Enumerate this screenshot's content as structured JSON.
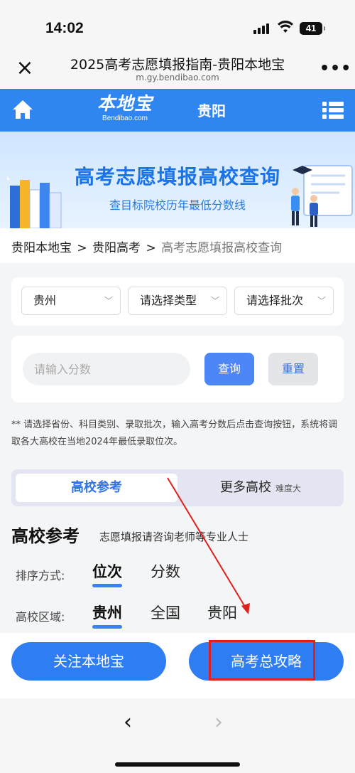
{
  "status_bar": {
    "time": "14:02",
    "battery": "41"
  },
  "browser": {
    "title": "2025高考志愿填报指南-贵阳本地宝",
    "url": "m.gy.bendibao.com",
    "more": "•••"
  },
  "site_nav": {
    "logo_cn": "本地宝",
    "logo_en": "Bendibao.com",
    "city": "贵阳"
  },
  "banner": {
    "title": "高考志愿填报高校查询",
    "subtitle": "查目标院校历年最低分数线"
  },
  "breadcrumb": {
    "items": [
      "贵阳本地宝",
      "贵阳高考"
    ],
    "separator": ">",
    "current": "高考志愿填报高校查询"
  },
  "selectors": {
    "province": "贵州",
    "type": "请选择类型",
    "batch": "请选择批次"
  },
  "score": {
    "placeholder": "请输入分数",
    "query_label": "查询",
    "reset_label": "重置"
  },
  "note": "** 请选择省份、科目类别、录取批次，输入高考分数后点击查询按钮，系统将调取各大高校在当地2024年最低录取位次。",
  "tabs": {
    "active": "高校参考",
    "more": "更多高校",
    "more_hint": "难度大"
  },
  "section": {
    "title": "高校参考",
    "subtitle": "志愿填报请咨询老师等专业人士"
  },
  "sort": {
    "label": "排序方式:",
    "options": [
      "位次",
      "分数"
    ]
  },
  "region": {
    "label": "高校区域:",
    "options": [
      "贵州",
      "全国",
      "贵阳"
    ]
  },
  "bottom_buttons": {
    "follow": "关注本地宝",
    "guide": "高考总攻略"
  },
  "browser_nav": {
    "back": "‹",
    "forward": "›"
  },
  "colors": {
    "brand_blue": "#2f7df2",
    "annotation_red": "#e0201c"
  }
}
